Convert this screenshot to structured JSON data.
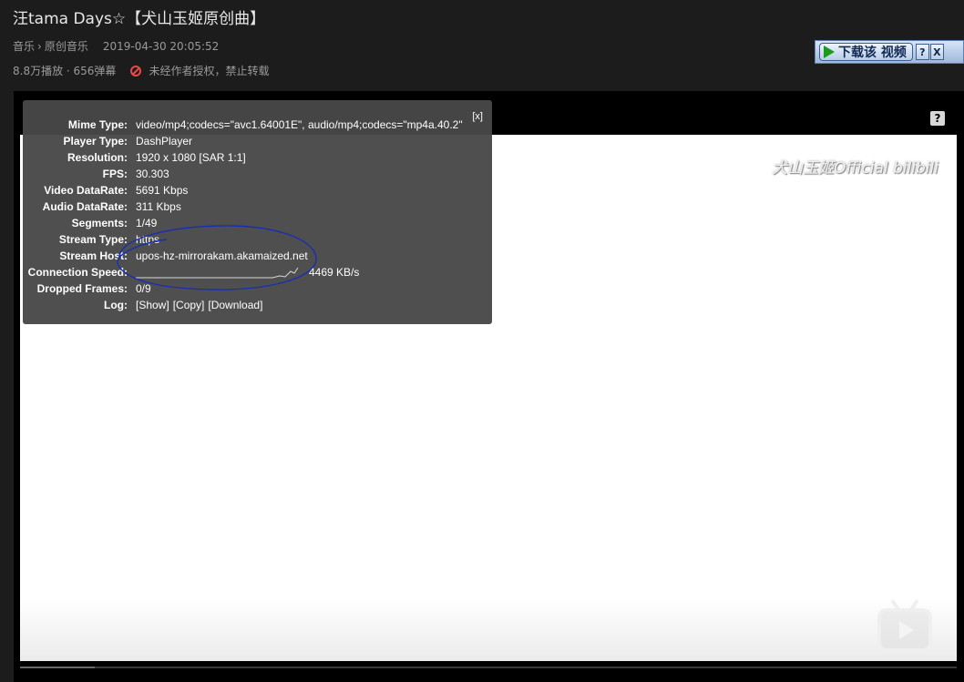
{
  "page": {
    "title": "汪tama Days☆【犬山玉姬原创曲】",
    "breadcrumb": [
      "音乐",
      "原创音乐"
    ],
    "breadcrumb_separator": "›",
    "publish_time": "2019-04-30 20:05:52",
    "play_stats": "8.8万播放 · 656弹幕",
    "copyright_notice": "未经作者授权，禁止转载"
  },
  "download_button": {
    "label": "下载该 视频",
    "extra": [
      "?",
      "X"
    ]
  },
  "player": {
    "help_label": "?",
    "watermark": "犬山玉姬Official bilibili",
    "progress": 0.08,
    "stats_panel": {
      "close_label": "[x]",
      "rows": [
        {
          "key": "Mime Type:",
          "value": "video/mp4;codecs=\"avc1.64001E\", audio/mp4;codecs=\"mp4a.40.2\""
        },
        {
          "key": "Player Type:",
          "value": "DashPlayer"
        },
        {
          "key": "Resolution:",
          "value": "1920 x 1080 [SAR 1:1]"
        },
        {
          "key": "FPS:",
          "value": "30.303"
        },
        {
          "key": "Video DataRate:",
          "value": "5691 Kbps"
        },
        {
          "key": "Audio DataRate:",
          "value": "311 Kbps"
        },
        {
          "key": "Segments:",
          "value": "1/49"
        },
        {
          "key": "Stream Type:",
          "value": "https"
        },
        {
          "key": "Stream Host:",
          "value": "upos-hz-mirrorakam.akamaized.net"
        }
      ],
      "connection_speed": {
        "key": "Connection Speed:",
        "value": "4469 KB/s"
      },
      "dropped_frames": {
        "key": "Dropped Frames:",
        "value": "0/9"
      },
      "log": {
        "key": "Log:",
        "links": [
          "[Show]",
          "[Copy]",
          "[Download]"
        ]
      }
    }
  },
  "colors": {
    "background": "#1c1c1c",
    "panel": "#484848",
    "forbid": "#e84a4a",
    "annotation": "#1a2fb0"
  }
}
